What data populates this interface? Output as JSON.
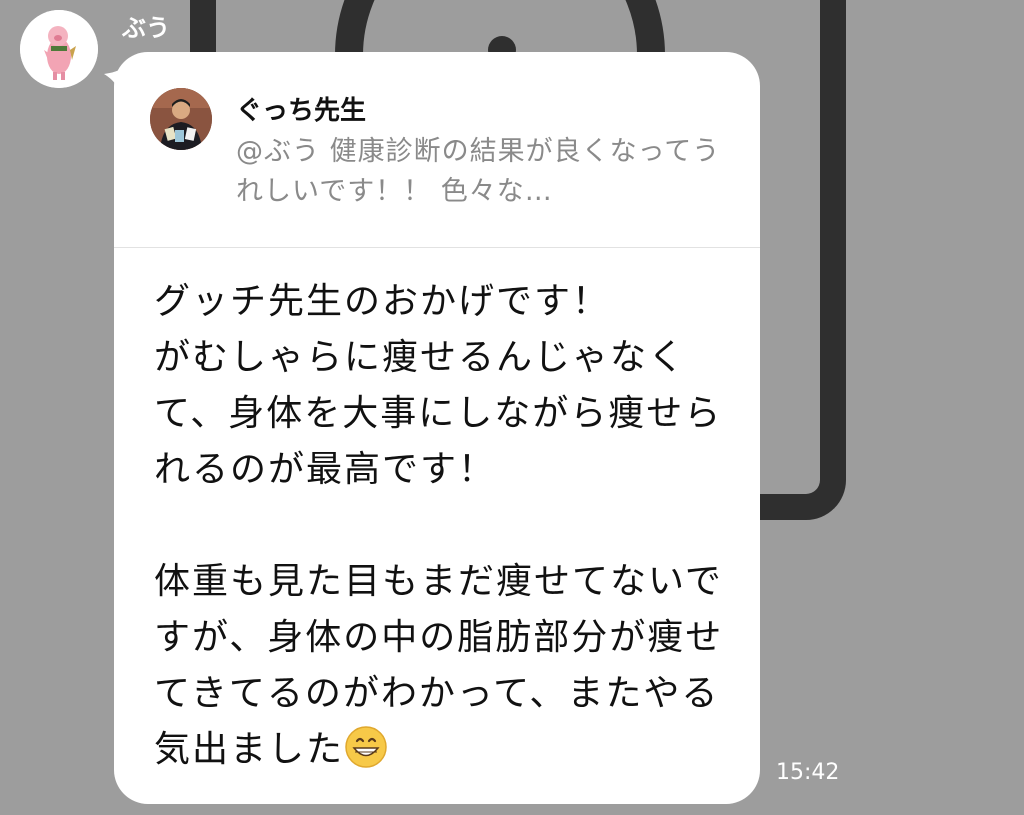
{
  "chat": {
    "sender_name": "ぶう",
    "reply_preview": {
      "author": "ぐっち先生",
      "text": "@ぶう 健康診断の結果が良くなってうれしいです！！ 色々な…"
    },
    "message": {
      "text": "グッチ先生のおかげです！\nがむしゃらに痩せるんじゃなくて、身体を大事にしながら痩せられるのが最高です！\n\n体重も見た目もまだ痩せてないですが、身体の中の脂肪部分が痩せてきてるのがわかって、またやる気出ました",
      "emoji": "grinning-face-icon"
    },
    "timestamp": "15:42"
  },
  "colors": {
    "background": "#9d9d9d",
    "bubble": "#ffffff",
    "reply_text": "#8a8a8a"
  }
}
